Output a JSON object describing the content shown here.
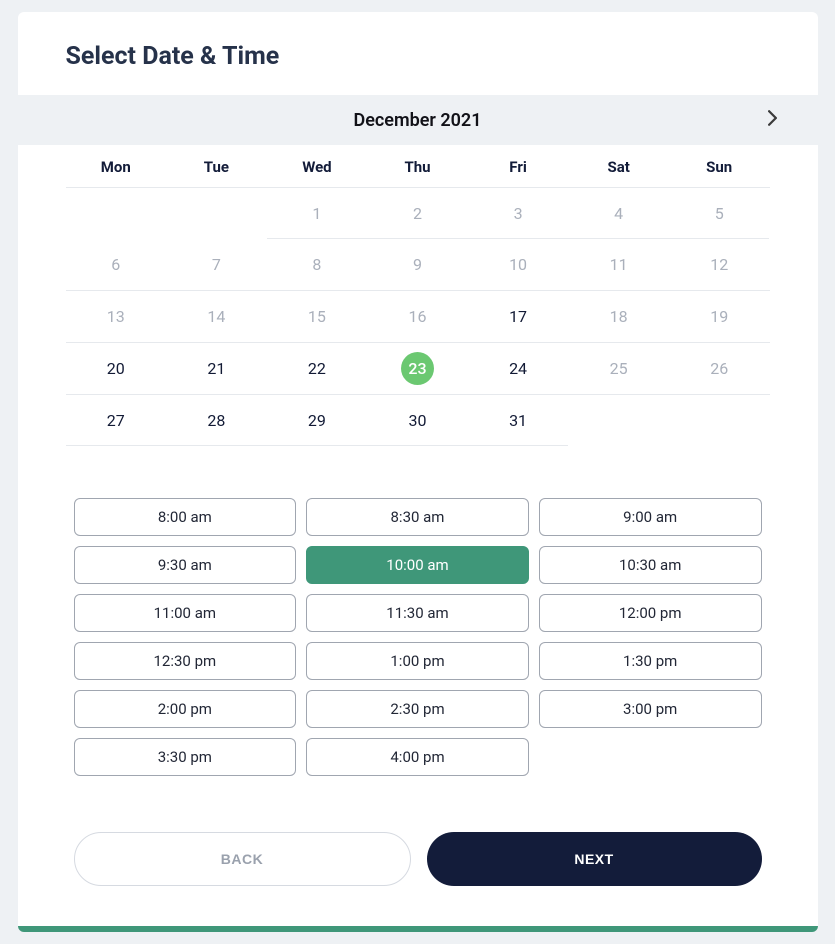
{
  "page_title": "Select Date & Time",
  "month_label": "December 2021",
  "days_of_week": [
    "Mon",
    "Tue",
    "Wed",
    "Thu",
    "Fri",
    "Sat",
    "Sun"
  ],
  "weeks": [
    [
      {
        "n": "",
        "state": "empty"
      },
      {
        "n": "",
        "state": "empty"
      },
      {
        "n": "1",
        "state": "disabled"
      },
      {
        "n": "2",
        "state": "disabled"
      },
      {
        "n": "3",
        "state": "disabled"
      },
      {
        "n": "4",
        "state": "disabled"
      },
      {
        "n": "5",
        "state": "disabled"
      }
    ],
    [
      {
        "n": "6",
        "state": "disabled"
      },
      {
        "n": "7",
        "state": "disabled"
      },
      {
        "n": "8",
        "state": "disabled"
      },
      {
        "n": "9",
        "state": "disabled"
      },
      {
        "n": "10",
        "state": "disabled"
      },
      {
        "n": "11",
        "state": "disabled"
      },
      {
        "n": "12",
        "state": "disabled"
      }
    ],
    [
      {
        "n": "13",
        "state": "disabled"
      },
      {
        "n": "14",
        "state": "disabled"
      },
      {
        "n": "15",
        "state": "disabled"
      },
      {
        "n": "16",
        "state": "disabled"
      },
      {
        "n": "17",
        "state": "active"
      },
      {
        "n": "18",
        "state": "disabled"
      },
      {
        "n": "19",
        "state": "disabled"
      }
    ],
    [
      {
        "n": "20",
        "state": "active"
      },
      {
        "n": "21",
        "state": "active"
      },
      {
        "n": "22",
        "state": "active"
      },
      {
        "n": "23",
        "state": "selected"
      },
      {
        "n": "24",
        "state": "active"
      },
      {
        "n": "25",
        "state": "disabled"
      },
      {
        "n": "26",
        "state": "disabled"
      }
    ],
    [
      {
        "n": "27",
        "state": "active"
      },
      {
        "n": "28",
        "state": "active"
      },
      {
        "n": "29",
        "state": "active"
      },
      {
        "n": "30",
        "state": "active"
      },
      {
        "n": "31",
        "state": "active"
      },
      {
        "n": "",
        "state": "empty"
      },
      {
        "n": "",
        "state": "empty"
      }
    ]
  ],
  "time_slots": [
    {
      "label": "8:00 am",
      "selected": false
    },
    {
      "label": "8:30 am",
      "selected": false
    },
    {
      "label": "9:00 am",
      "selected": false
    },
    {
      "label": "9:30 am",
      "selected": false
    },
    {
      "label": "10:00 am",
      "selected": true
    },
    {
      "label": "10:30 am",
      "selected": false
    },
    {
      "label": "11:00 am",
      "selected": false
    },
    {
      "label": "11:30 am",
      "selected": false
    },
    {
      "label": "12:00 pm",
      "selected": false
    },
    {
      "label": "12:30 pm",
      "selected": false
    },
    {
      "label": "1:00 pm",
      "selected": false
    },
    {
      "label": "1:30 pm",
      "selected": false
    },
    {
      "label": "2:00 pm",
      "selected": false
    },
    {
      "label": "2:30 pm",
      "selected": false
    },
    {
      "label": "3:00 pm",
      "selected": false
    },
    {
      "label": "3:30 pm",
      "selected": false
    },
    {
      "label": "4:00 pm",
      "selected": false
    }
  ],
  "buttons": {
    "back": "BACK",
    "next": "NEXT"
  },
  "colors": {
    "accent_green": "#3f9779",
    "selected_day": "#6bc871",
    "primary_dark": "#131c3a"
  }
}
